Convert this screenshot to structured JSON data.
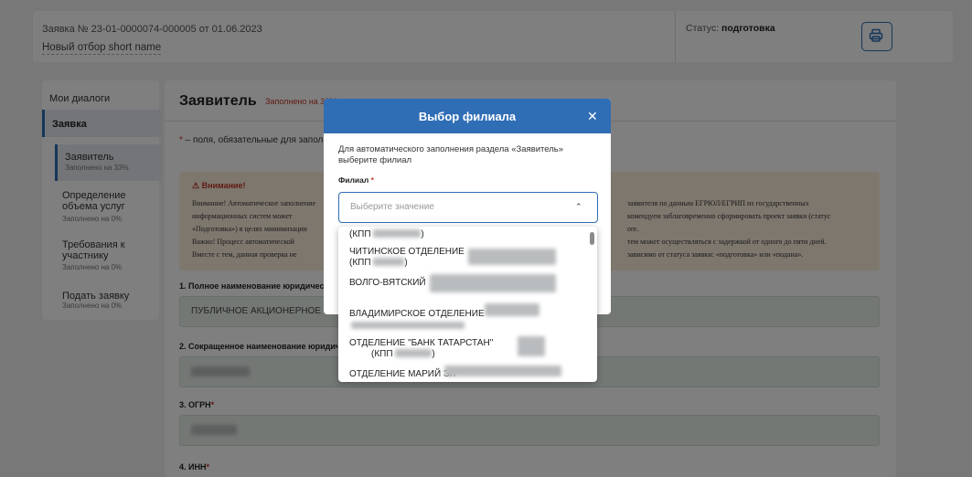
{
  "header": {
    "application_number": "Заявка № 23-01-0000074-000005 от 01.06.2023",
    "selection_name": "Новый отбор short name",
    "status_label": "Статус:",
    "status_value": "подготовка",
    "print_icon": "printer-icon"
  },
  "sidebar": {
    "dialogs": "Мои диалоги",
    "section": "Заявка",
    "items": [
      {
        "label": "Заявитель",
        "sub": "Заполнено на 33%"
      },
      {
        "label": "Определение объема услуг",
        "sub": "Заполнено на 0%"
      },
      {
        "label": "Требования к участнику",
        "sub": "Заполнено на 0%"
      },
      {
        "label": "Подать заявку",
        "sub": "Заполнено на 0%"
      }
    ]
  },
  "main": {
    "title": "Заявитель",
    "fill_note": "Заполнено на 33%",
    "required_note_star": "*",
    "required_note": " – поля, обязательные для заполнения",
    "warning": {
      "heading": "⚠ Внимание!",
      "line1a": "Внимание! Автоматическое заполнение",
      "line1b": "заявителя по данным ЕГРЮЛ/ЕГРИП из государственных",
      "line2a": "информационных систем может",
      "line2b": "комендуем заблаговременно сформировать проект заявки (статус",
      "line3a": "«Подготовка») в целях минимизации",
      "line3b": "ore.",
      "line4a": "Важно! Процесс автоматической",
      "line4b": "тем может осуществляться с задержкой от одного до пяти дней.",
      "line5a": "Вместе с тем, данная проверка не",
      "line5b": "зависимо от статуса заявки: «подготовка» или «подана»."
    },
    "fields": [
      {
        "label": "1. Полное наименование юридичес",
        "value": "ПУБЛИЧНОЕ АКЦИОНЕРНОЕ О"
      },
      {
        "label": "2. Сокращенное наименование юридич",
        "value": ""
      },
      {
        "label": "3. ОГРН",
        "value": ""
      },
      {
        "label": "4. ИНН",
        "value": ""
      }
    ]
  },
  "modal": {
    "title": "Выбор филиала",
    "close_icon": "close-icon",
    "description": "Для автоматического заполнения раздела «Заявитель» выберите филиал",
    "field_label": "Филиал",
    "placeholder": "Выберите значение",
    "chevron": "chevron-up-icon"
  },
  "dropdown": {
    "items": [
      {
        "line1": "(КПП",
        "line2": ")"
      },
      {
        "line1": "ЧИТИНСКОЕ ОТДЕЛЕНИЕ",
        "line2": "(КПП",
        "line3": ")"
      },
      {
        "line1": "ВОЛГО-ВЯТСКИЙ"
      },
      {
        "line1": "ВЛАДИМИРСКОЕ ОТДЕЛЕНИЕ"
      },
      {
        "line1": "ОТДЕЛЕНИЕ \"БАНК ТАТАРСТАН\"",
        "line2": "(КПП",
        "line3": ")"
      },
      {
        "line1": "ОТДЕЛЕНИЕ МАРИЙ ЭЛ"
      }
    ]
  }
}
